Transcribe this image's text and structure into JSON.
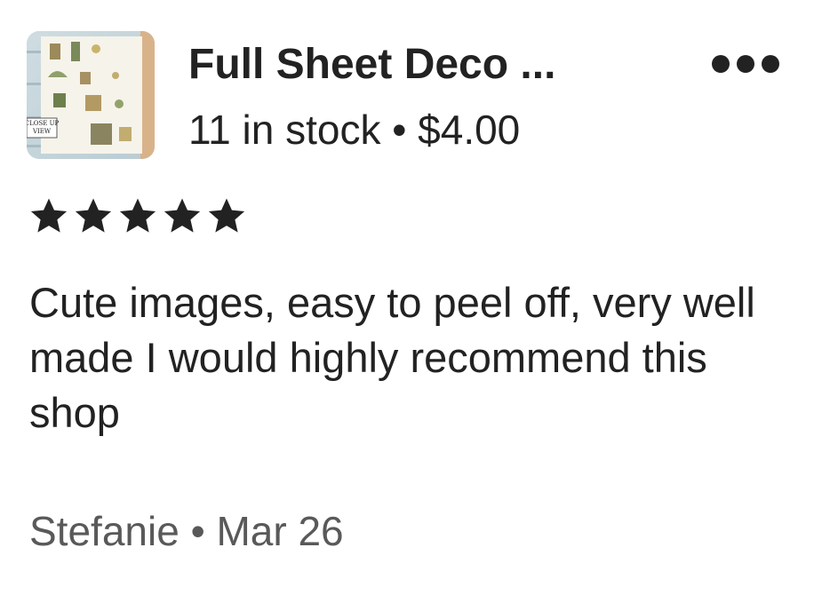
{
  "listing": {
    "title": "Full Sheet Deco ...",
    "stock": "11 in stock",
    "separator": "•",
    "price": "$4.00",
    "thumbnail_label": "CLOSE UP VIEW"
  },
  "rating": {
    "stars": 5,
    "max": 5
  },
  "review": {
    "text": "Cute images, easy to peel off, very well made I would highly recommend this shop"
  },
  "reviewer": {
    "name": "Stefanie",
    "separator": "•",
    "date": "Mar 26"
  },
  "icons": {
    "more": "more-horizontal-icon",
    "star": "star-filled-icon"
  },
  "colors": {
    "text_primary": "#222222",
    "text_secondary": "#595959",
    "star": "#222222"
  }
}
